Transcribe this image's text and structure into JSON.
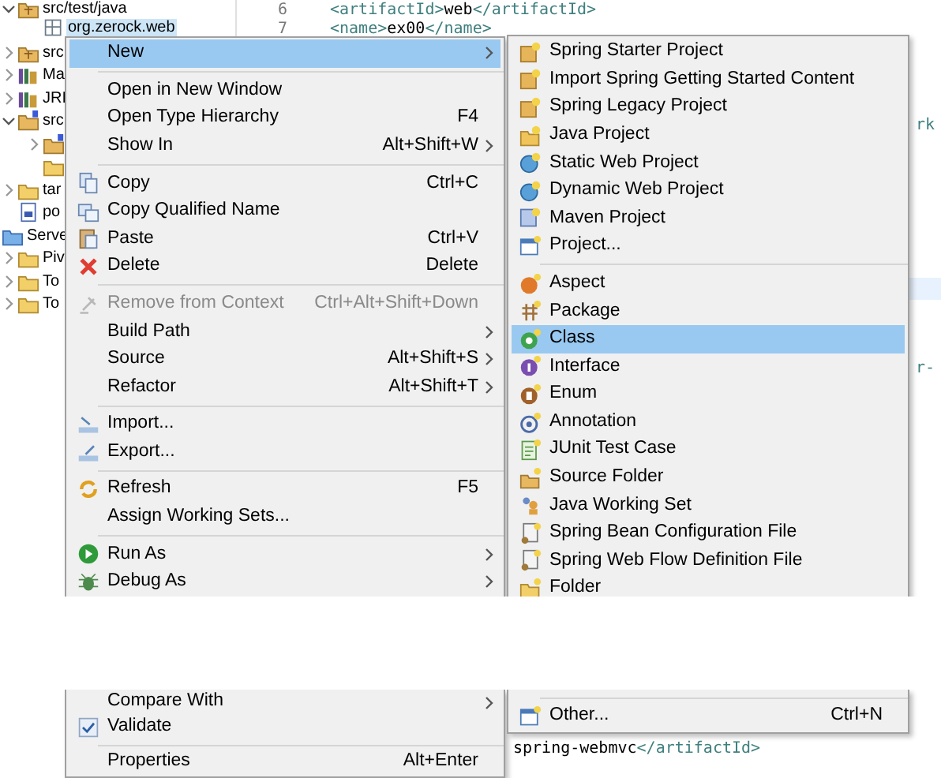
{
  "tree": [
    {
      "label": "src/test/java",
      "kind": "source-folder",
      "expanded": true,
      "selected": false,
      "children": [
        {
          "label": "org.zerock.web",
          "kind": "package",
          "selected": true
        }
      ]
    },
    {
      "label": "src",
      "kind": "source-folder",
      "expanded": false,
      "selected": false
    },
    {
      "label": "Ma",
      "kind": "library",
      "expanded": false,
      "selected": false
    },
    {
      "label": "JRI",
      "kind": "library",
      "expanded": false,
      "selected": false
    },
    {
      "label": "src",
      "kind": "spring-folder",
      "expanded": true,
      "selected": false,
      "children": [
        {
          "kind": "spring-folder",
          "expanded": false,
          "selected": false
        },
        {
          "kind": "folder",
          "selected": false
        }
      ]
    },
    {
      "label": "tar",
      "kind": "folder",
      "expanded": false,
      "selected": false
    },
    {
      "label": "po",
      "kind": "file",
      "selected": false
    },
    {
      "label": "Serve",
      "kind": "server-root",
      "selected": false,
      "children": [
        {
          "label": "Piv",
          "kind": "folder",
          "expanded": false,
          "selected": false
        },
        {
          "label": "To",
          "kind": "folder",
          "expanded": false,
          "selected": false
        },
        {
          "label": "To",
          "kind": "folder",
          "expanded": false,
          "selected": false
        }
      ]
    }
  ],
  "editor": {
    "lines": [
      {
        "number": "6",
        "code": [
          {
            "kind": "tag",
            "text": "<artifactId>"
          },
          {
            "kind": "text",
            "text": "web"
          },
          {
            "kind": "tag",
            "text": "</artifactId>"
          }
        ]
      },
      {
        "number": "7",
        "code": [
          {
            "kind": "tag",
            "text": "<name>"
          },
          {
            "kind": "text",
            "text": "ex00"
          },
          {
            "kind": "tag",
            "text": "</name>"
          }
        ]
      }
    ],
    "edge_fragments": [
      "rk",
      "r-"
    ],
    "lower_line": [
      {
        "kind": "text",
        "text": "spring-webmvc"
      },
      {
        "kind": "tag",
        "text": "</artifactId>"
      }
    ]
  },
  "context_menu": {
    "items_upper": [
      {
        "kind": "item",
        "label": "New",
        "submenu": true,
        "selected": true,
        "disabled": false
      },
      {
        "kind": "separator"
      },
      {
        "kind": "item",
        "label": "Open in New Window",
        "selected": false,
        "disabled": false
      },
      {
        "kind": "item",
        "label": "Open Type Hierarchy",
        "shortcut": "F4",
        "selected": false,
        "disabled": false
      },
      {
        "kind": "item",
        "label": "Show In",
        "shortcut": "Alt+Shift+W",
        "submenu": true,
        "selected": false,
        "disabled": false
      },
      {
        "kind": "separator"
      },
      {
        "kind": "item",
        "label": "Copy",
        "shortcut": "Ctrl+C",
        "selected": false,
        "disabled": false
      },
      {
        "kind": "item",
        "label": "Copy Qualified Name",
        "selected": false,
        "disabled": false
      },
      {
        "kind": "item",
        "label": "Paste",
        "shortcut": "Ctrl+V",
        "selected": false,
        "disabled": false
      },
      {
        "kind": "item",
        "label": "Delete",
        "shortcut": "Delete",
        "selected": false,
        "disabled": false
      },
      {
        "kind": "separator"
      },
      {
        "kind": "item",
        "label": "Remove from Context",
        "shortcut": "Ctrl+Alt+Shift+Down",
        "selected": false,
        "disabled": true
      },
      {
        "kind": "item",
        "label": "Build Path",
        "submenu": true,
        "selected": false,
        "disabled": false
      },
      {
        "kind": "item",
        "label": "Source",
        "shortcut": "Alt+Shift+S",
        "submenu": true,
        "selected": false,
        "disabled": false
      },
      {
        "kind": "item",
        "label": "Refactor",
        "shortcut": "Alt+Shift+T",
        "submenu": true,
        "selected": false,
        "disabled": false
      },
      {
        "kind": "separator"
      },
      {
        "kind": "item",
        "label": "Import...",
        "selected": false,
        "disabled": false
      },
      {
        "kind": "item",
        "label": "Export...",
        "selected": false,
        "disabled": false
      },
      {
        "kind": "separator"
      },
      {
        "kind": "item",
        "label": "Refresh",
        "shortcut": "F5",
        "selected": false,
        "disabled": false
      },
      {
        "kind": "item",
        "label": "Assign Working Sets...",
        "selected": false,
        "disabled": false
      },
      {
        "kind": "separator"
      },
      {
        "kind": "item",
        "label": "Run As",
        "submenu": true,
        "selected": false,
        "disabled": false
      },
      {
        "kind": "item",
        "label": "Debug As",
        "submenu": true,
        "selected": false,
        "disabled": false
      }
    ],
    "items_lower": [
      {
        "kind": "item",
        "label": "Compare With",
        "submenu": true,
        "selected": false,
        "disabled": false
      },
      {
        "kind": "item",
        "label": "Validate",
        "selected": false,
        "disabled": false
      },
      {
        "kind": "separator"
      },
      {
        "kind": "item",
        "label": "Properties",
        "shortcut": "Alt+Enter",
        "selected": false,
        "disabled": false
      }
    ]
  },
  "new_submenu": {
    "items_upper": [
      {
        "kind": "item",
        "label": "Spring Starter Project",
        "selected": false
      },
      {
        "kind": "item",
        "label": "Import Spring Getting Started Content",
        "selected": false
      },
      {
        "kind": "item",
        "label": "Spring Legacy Project",
        "selected": false
      },
      {
        "kind": "item",
        "label": "Java Project",
        "selected": false
      },
      {
        "kind": "item",
        "label": "Static Web Project",
        "selected": false
      },
      {
        "kind": "item",
        "label": "Dynamic Web Project",
        "selected": false
      },
      {
        "kind": "item",
        "label": "Maven Project",
        "selected": false
      },
      {
        "kind": "item",
        "label": "Project...",
        "selected": false
      },
      {
        "kind": "separator"
      },
      {
        "kind": "item",
        "label": "Aspect",
        "selected": false
      },
      {
        "kind": "item",
        "label": "Package",
        "selected": false
      },
      {
        "kind": "item",
        "label": "Class",
        "selected": true
      },
      {
        "kind": "item",
        "label": "Interface",
        "selected": false
      },
      {
        "kind": "item",
        "label": "Enum",
        "selected": false
      },
      {
        "kind": "item",
        "label": "Annotation",
        "selected": false
      },
      {
        "kind": "item",
        "label": "JUnit Test Case",
        "selected": false
      },
      {
        "kind": "item",
        "label": "Source Folder",
        "selected": false
      },
      {
        "kind": "item",
        "label": "Java Working Set",
        "selected": false
      },
      {
        "kind": "item",
        "label": "Spring Bean Configuration File",
        "selected": false
      },
      {
        "kind": "item",
        "label": "Spring Web Flow Definition File",
        "selected": false
      },
      {
        "kind": "item",
        "label": "Folder",
        "selected": false
      }
    ],
    "items_lower": [
      {
        "kind": "separator"
      },
      {
        "kind": "item",
        "label": "Other...",
        "shortcut": "Ctrl+N",
        "selected": false
      }
    ]
  }
}
